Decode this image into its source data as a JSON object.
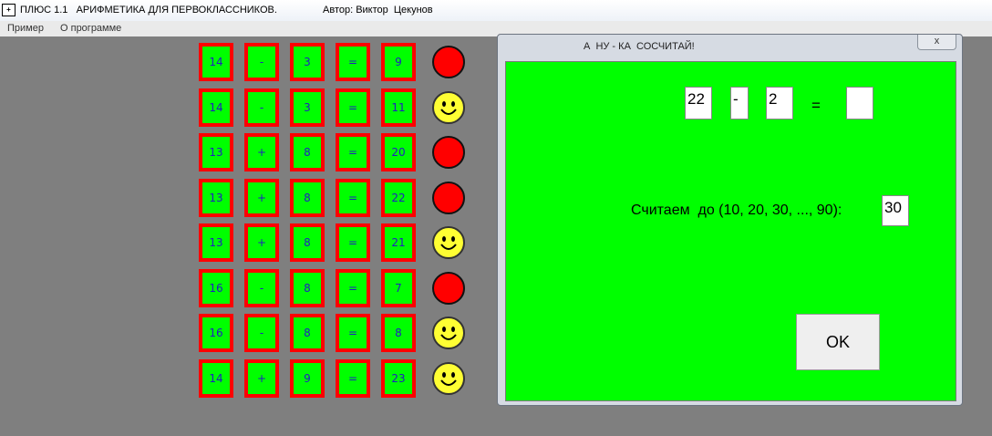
{
  "window": {
    "title": "ПЛЮС 1.1   АРИФМЕТИКА ДЛЯ ПЕРВОКЛАССНИКОВ.",
    "author": "Автор: Виктор  Цекунов",
    "icon": "app-icon"
  },
  "menu": [
    "Пример",
    "О программе"
  ],
  "history": [
    {
      "a": "14",
      "op": "-",
      "b": "3",
      "eq": "=",
      "ans": "9",
      "status": "wrong"
    },
    {
      "a": "14",
      "op": "-",
      "b": "3",
      "eq": "=",
      "ans": "11",
      "status": "right"
    },
    {
      "a": "13",
      "op": "+",
      "b": "8",
      "eq": "=",
      "ans": "20",
      "status": "wrong"
    },
    {
      "a": "13",
      "op": "+",
      "b": "8",
      "eq": "=",
      "ans": "22",
      "status": "wrong"
    },
    {
      "a": "13",
      "op": "+",
      "b": "8",
      "eq": "=",
      "ans": "21",
      "status": "right"
    },
    {
      "a": "16",
      "op": "-",
      "b": "8",
      "eq": "=",
      "ans": "7",
      "status": "wrong"
    },
    {
      "a": "16",
      "op": "-",
      "b": "8",
      "eq": "=",
      "ans": "8",
      "status": "right"
    },
    {
      "a": "14",
      "op": "+",
      "b": "9",
      "eq": "=",
      "ans": "23",
      "status": "right"
    }
  ],
  "status_icons": {
    "wrong": "red-circle-icon",
    "right": "smiley-face-icon"
  },
  "colors": {
    "cell_bg": "#00ff00",
    "cell_border": "#ff0000",
    "cell_text": "#2020c0",
    "wrong": "#ff0000",
    "right": "#ffff33"
  },
  "dialog": {
    "title": "А  НУ - КА  СОСЧИТАЙ!",
    "close_label": "x",
    "operand_a": "22",
    "operator": "-",
    "operand_b": "2",
    "equals": "=",
    "answer": "",
    "range_label": "Считаем  до (10, 20, 30, ..., 90):",
    "range_value": "30",
    "ok_label": "OK"
  }
}
